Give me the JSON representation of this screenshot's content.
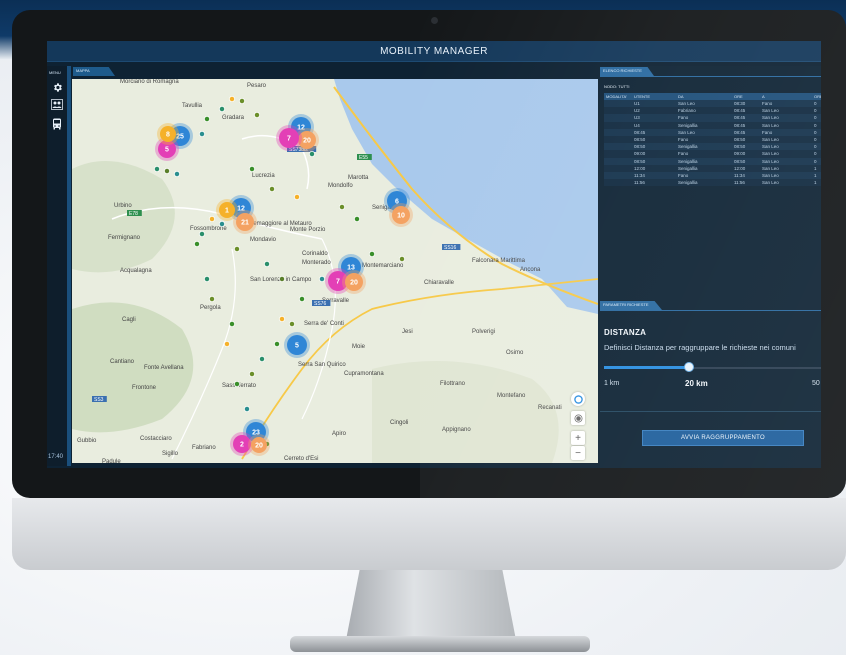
{
  "app": {
    "title": "MOBILITY MANAGER"
  },
  "sidebar": {
    "menu_label": "MENU",
    "time": "17:40",
    "icons": [
      "gear-icon",
      "people-icon",
      "bus-icon"
    ]
  },
  "map": {
    "tab_label": "MAPPA",
    "places": [
      "Pesaro",
      "Morciano di Romagna",
      "Tavullia",
      "Gradara",
      "Urbino",
      "Fermignano",
      "Acqualagna",
      "Cagli",
      "Cantiano",
      "Frontone",
      "Fonte Avellana",
      "Sassoferrato",
      "Gubbio",
      "Costacciaro",
      "Sigillo",
      "Padule",
      "Cerreto d'Esi",
      "Fabriano",
      "Pergola",
      "Fossombrone",
      "Montemaggiore al Metauro",
      "Mondavio",
      "Monte Porzio",
      "Corinaldo",
      "Lucrezia",
      "Mondolfo",
      "Marotta",
      "Senigallia",
      "San Lorenzo in Campo",
      "Serra de' Conti",
      "Serra San Quirico",
      "Cupramontana",
      "Jesi",
      "Chiaravalle",
      "Falconara Marittima",
      "Ancona",
      "Polverigi",
      "Moie",
      "Filottrano",
      "Montefano",
      "Recanati",
      "Osimo",
      "Cingoli",
      "Appignano",
      "Apiro",
      "Monterado",
      "Montemarciano",
      "Serravalle"
    ],
    "road_labels": [
      "SS76",
      "SS73bis",
      "E55",
      "E78",
      "SS16",
      "SS3"
    ],
    "zoom_in": "+",
    "zoom_out": "−"
  },
  "clusters": [
    {
      "label": "25",
      "color": "#2f86d6"
    },
    {
      "label": "5",
      "color": "#e33fb6"
    },
    {
      "label": "8",
      "color": "#f5b12a"
    },
    {
      "label": "12",
      "color": "#2f86d6"
    },
    {
      "label": "20",
      "color": "#f4a262"
    },
    {
      "label": "7",
      "color": "#e33fb6"
    },
    {
      "label": "12",
      "color": "#2f86d6"
    },
    {
      "label": "21",
      "color": "#f4a262"
    },
    {
      "label": "1",
      "color": "#f5b12a"
    },
    {
      "label": "6",
      "color": "#2f86d6"
    },
    {
      "label": "10",
      "color": "#f4a262"
    },
    {
      "label": "13",
      "color": "#2f86d6"
    },
    {
      "label": "7",
      "color": "#e33fb6"
    },
    {
      "label": "20",
      "color": "#f4a262"
    },
    {
      "label": "5",
      "color": "#2f86d6"
    },
    {
      "label": "23",
      "color": "#2f86d6"
    },
    {
      "label": "2",
      "color": "#e33fb6"
    },
    {
      "label": "20",
      "color": "#f4a262"
    }
  ],
  "requests": {
    "tab_label": "ELENCO RICHIESTE",
    "filter_label": "NODO: TUTTI",
    "columns": [
      "MODALITA'",
      "UTENTE",
      "DA",
      "ORE",
      "A",
      "ORE"
    ],
    "rows": [
      [
        "",
        "U1",
        "San Leo",
        "08:30",
        "Fano",
        "0"
      ],
      [
        "",
        "U2",
        "Fabriano",
        "08:45",
        "San Leo",
        "0"
      ],
      [
        "",
        "U3",
        "Fano",
        "08:45",
        "San Leo",
        "0"
      ],
      [
        "",
        "U4",
        "Senigallia",
        "08:45",
        "San Leo",
        "0"
      ],
      [
        "",
        "08:45",
        "San Leo",
        "08:45",
        "Fano",
        "0"
      ],
      [
        "",
        "08:50",
        "Fano",
        "08:50",
        "San Leo",
        "0"
      ],
      [
        "",
        "08:50",
        "Senigallia",
        "08:50",
        "San Leo",
        "0"
      ],
      [
        "",
        "09:00",
        "Fano",
        "09:00",
        "San Leo",
        "0"
      ],
      [
        "",
        "08:50",
        "Senigallia",
        "08:50",
        "San Leo",
        "0"
      ],
      [
        "",
        "12:00",
        "Senigallia",
        "12:00",
        "San Leo",
        "1"
      ],
      [
        "",
        "11:34",
        "Fano",
        "11:34",
        "San Leo",
        "1"
      ],
      [
        "",
        "11:56",
        "Senigallia",
        "11:56",
        "San Leo",
        "1"
      ]
    ]
  },
  "params": {
    "tab_label": "PARAMETRI RICHIESTE",
    "distance_title": "DISTANZA",
    "distance_desc": "Definisci Distanza per raggruppare le richieste nei comuni",
    "slider_min": "1 km",
    "slider_value_label": "20 km",
    "slider_max": "50",
    "slider_fraction": 0.39,
    "button_label": "AVVIA RAGGRUPPAMENTO"
  },
  "colors": {
    "accent": "#2a8ee0",
    "panel": "#0f2435",
    "sea": "#a9c9ec",
    "land": "#e9eddf"
  }
}
